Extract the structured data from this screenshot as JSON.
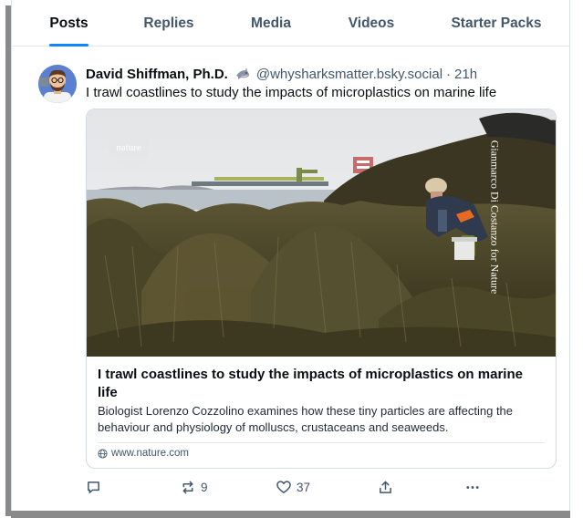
{
  "tabs": [
    {
      "label": "Posts",
      "active": true
    },
    {
      "label": "Replies",
      "active": false
    },
    {
      "label": "Media",
      "active": false
    },
    {
      "label": "Videos",
      "active": false
    },
    {
      "label": "Starter Packs",
      "active": false
    }
  ],
  "post": {
    "author_name": "David Shiffman, Ph.D.",
    "verified_icon": "shark-emoji-icon",
    "handle": "@whysharksmatter.bsky.social",
    "separator": "·",
    "time": "21h",
    "text": "I trawl coastlines to study the impacts of microplastics on marine life"
  },
  "link_card": {
    "badge_text": "nature",
    "photo_credit": "Gianmarco Di Costanzo for Nature",
    "title": "I trawl coastlines to study the impacts of microplastics on marine life",
    "description": "Biologist Lorenzo Cozzolino examines how these tiny particles are affecting the behaviour and physiology of molluscs, crustaceans and seaweeds.",
    "domain": "www.nature.com",
    "domain_icon": "globe-icon"
  },
  "actions": {
    "reply_count": "",
    "repost_count": "9",
    "like_count": "37"
  },
  "colors": {
    "accent": "#1083fe",
    "muted_text": "#42576c",
    "border": "#d4dbe2"
  }
}
